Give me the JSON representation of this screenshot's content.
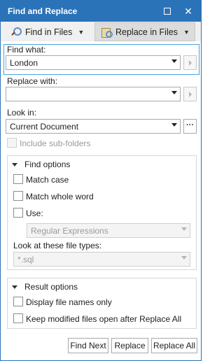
{
  "window": {
    "title": "Find and Replace"
  },
  "tabs": [
    {
      "label": "Find in Files"
    },
    {
      "label": "Replace in Files"
    }
  ],
  "find_what": {
    "label": "Find what:",
    "value": "London"
  },
  "replace_with": {
    "label": "Replace with:",
    "value": ""
  },
  "look_in": {
    "label": "Look in:",
    "value": "Current Document"
  },
  "include_subfolders": {
    "label": "Include sub-folders",
    "checked": false,
    "enabled": false
  },
  "find_options": {
    "header": "Find options",
    "match_case": "Match case",
    "match_whole_word": "Match whole word",
    "use": "Use:",
    "use_value": "Regular Expressions",
    "file_types_label": "Look at these file types:",
    "file_types_value": "*.sql"
  },
  "result_options": {
    "header": "Result options",
    "display_names_only": "Display file names only",
    "keep_modified_open": "Keep modified files open after Replace All"
  },
  "buttons": {
    "find_next": "Find Next",
    "replace": "Replace",
    "replace_all": "Replace All"
  },
  "colors": {
    "accent": "#2b73b8",
    "focus": "#4aa3d8"
  }
}
